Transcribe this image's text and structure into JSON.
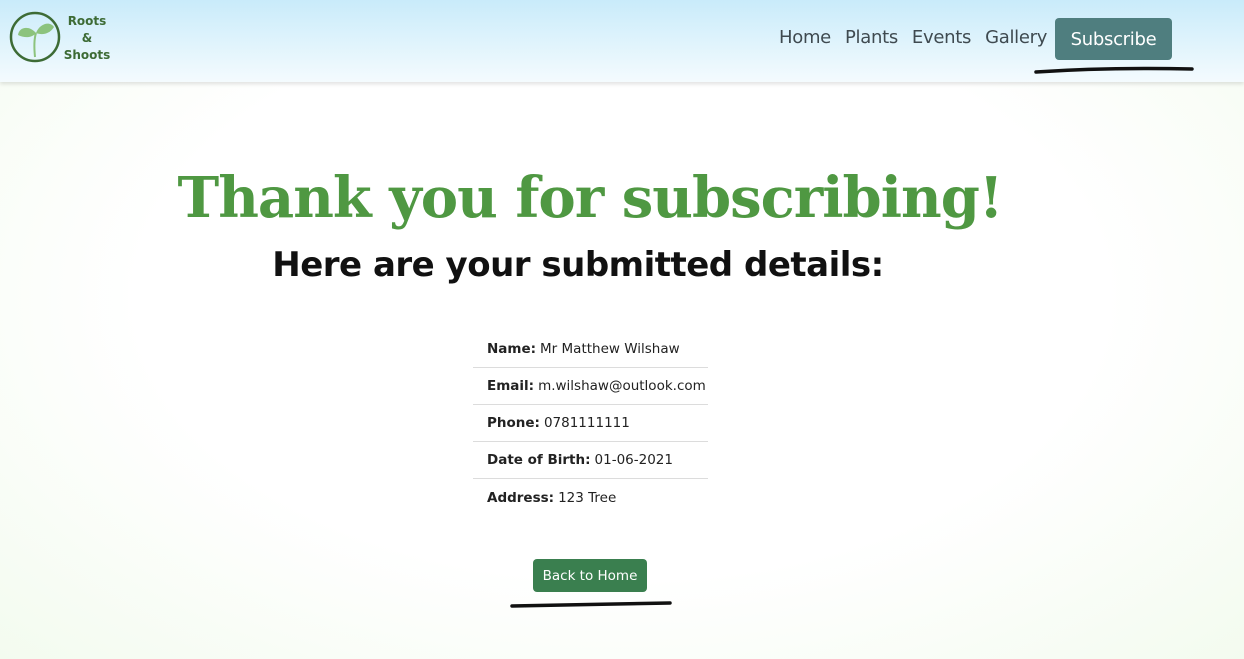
{
  "brand": {
    "line1": "Roots",
    "line2": "&",
    "line3": "Shoots"
  },
  "nav": {
    "items": [
      "Home",
      "Plants",
      "Events",
      "Gallery"
    ],
    "subscribe_label": "Subscribe"
  },
  "main": {
    "heading": "Thank you for subscribing!",
    "subheading": "Here are your submitted details:",
    "details": [
      {
        "label": "Name:",
        "value": "Mr Matthew Wilshaw"
      },
      {
        "label": "Email:",
        "value": "m.wilshaw@outlook.com"
      },
      {
        "label": "Phone:",
        "value": "0781111111"
      },
      {
        "label": "Date of Birth:",
        "value": "01-06-2021"
      },
      {
        "label": "Address:",
        "value": "123 Tree"
      }
    ],
    "back_label": "Back to Home"
  },
  "colors": {
    "heading": "#4f9842",
    "subscribe_button": "#4f7e7f",
    "back_button": "#3a7f4f",
    "logo": "#3d6b35"
  },
  "icons": {
    "logo": "sprout-logo-icon"
  }
}
